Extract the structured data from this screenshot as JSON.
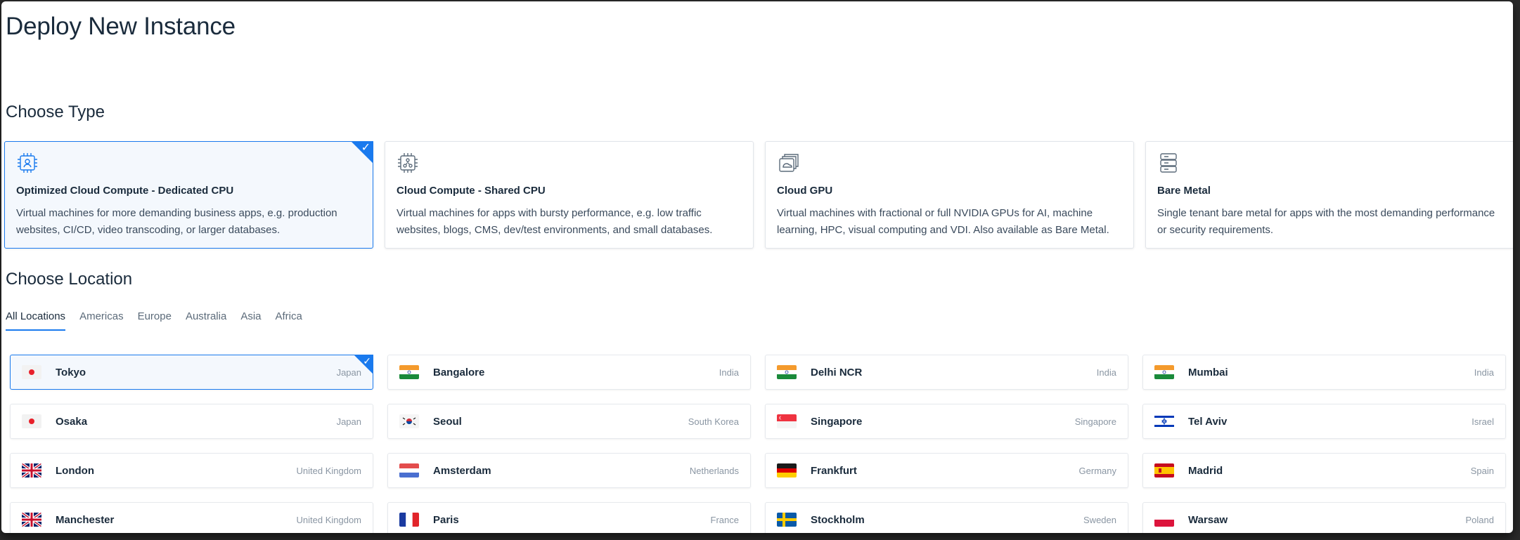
{
  "page": {
    "title": "Deploy New Instance"
  },
  "type_section": {
    "title": "Choose Type",
    "cards": [
      {
        "name": "Optimized Cloud Compute - Dedicated CPU",
        "desc": "Virtual machines for more demanding business apps, e.g. production websites, CI/CD, video transcoding, or larger databases.",
        "icon": "cpu-user-icon",
        "selected": true
      },
      {
        "name": "Cloud Compute - Shared CPU",
        "desc": "Virtual machines for apps with bursty performance, e.g. low traffic websites, blogs, CMS, dev/test environments, and small databases.",
        "icon": "cpu-shared-icon",
        "selected": false
      },
      {
        "name": "Cloud GPU",
        "desc": "Virtual machines with fractional or full NVIDIA GPUs for AI, machine learning, HPC, visual computing and VDI. Also available as Bare Metal.",
        "icon": "gpu-icon",
        "selected": false
      },
      {
        "name": "Bare Metal",
        "desc": "Single tenant bare metal for apps with the most demanding performance or security requirements.",
        "icon": "server-icon",
        "selected": false
      }
    ]
  },
  "location_section": {
    "title": "Choose Location",
    "tabs": [
      "All Locations",
      "Americas",
      "Europe",
      "Australia",
      "Asia",
      "Africa"
    ],
    "active_tab": "All Locations",
    "locations": [
      {
        "city": "Tokyo",
        "country": "Japan",
        "flag": "jp",
        "selected": true
      },
      {
        "city": "Bangalore",
        "country": "India",
        "flag": "in",
        "selected": false
      },
      {
        "city": "Delhi NCR",
        "country": "India",
        "flag": "in",
        "selected": false
      },
      {
        "city": "Mumbai",
        "country": "India",
        "flag": "in",
        "selected": false
      },
      {
        "city": "Osaka",
        "country": "Japan",
        "flag": "jp",
        "selected": false
      },
      {
        "city": "Seoul",
        "country": "South Korea",
        "flag": "kr",
        "selected": false
      },
      {
        "city": "Singapore",
        "country": "Singapore",
        "flag": "sg",
        "selected": false
      },
      {
        "city": "Tel Aviv",
        "country": "Israel",
        "flag": "il",
        "selected": false
      },
      {
        "city": "London",
        "country": "United Kingdom",
        "flag": "gb",
        "selected": false
      },
      {
        "city": "Amsterdam",
        "country": "Netherlands",
        "flag": "nl",
        "selected": false
      },
      {
        "city": "Frankfurt",
        "country": "Germany",
        "flag": "de",
        "selected": false
      },
      {
        "city": "Madrid",
        "country": "Spain",
        "flag": "es",
        "selected": false
      },
      {
        "city": "Manchester",
        "country": "United Kingdom",
        "flag": "gb",
        "selected": false
      },
      {
        "city": "Paris",
        "country": "France",
        "flag": "fr",
        "selected": false
      },
      {
        "city": "Stockholm",
        "country": "Sweden",
        "flag": "se",
        "selected": false
      },
      {
        "city": "Warsaw",
        "country": "Poland",
        "flag": "pl",
        "selected": false
      }
    ]
  },
  "colors": {
    "accent": "#1a7aee",
    "text": "#1a2b3c",
    "muted": "#8a96a3"
  }
}
